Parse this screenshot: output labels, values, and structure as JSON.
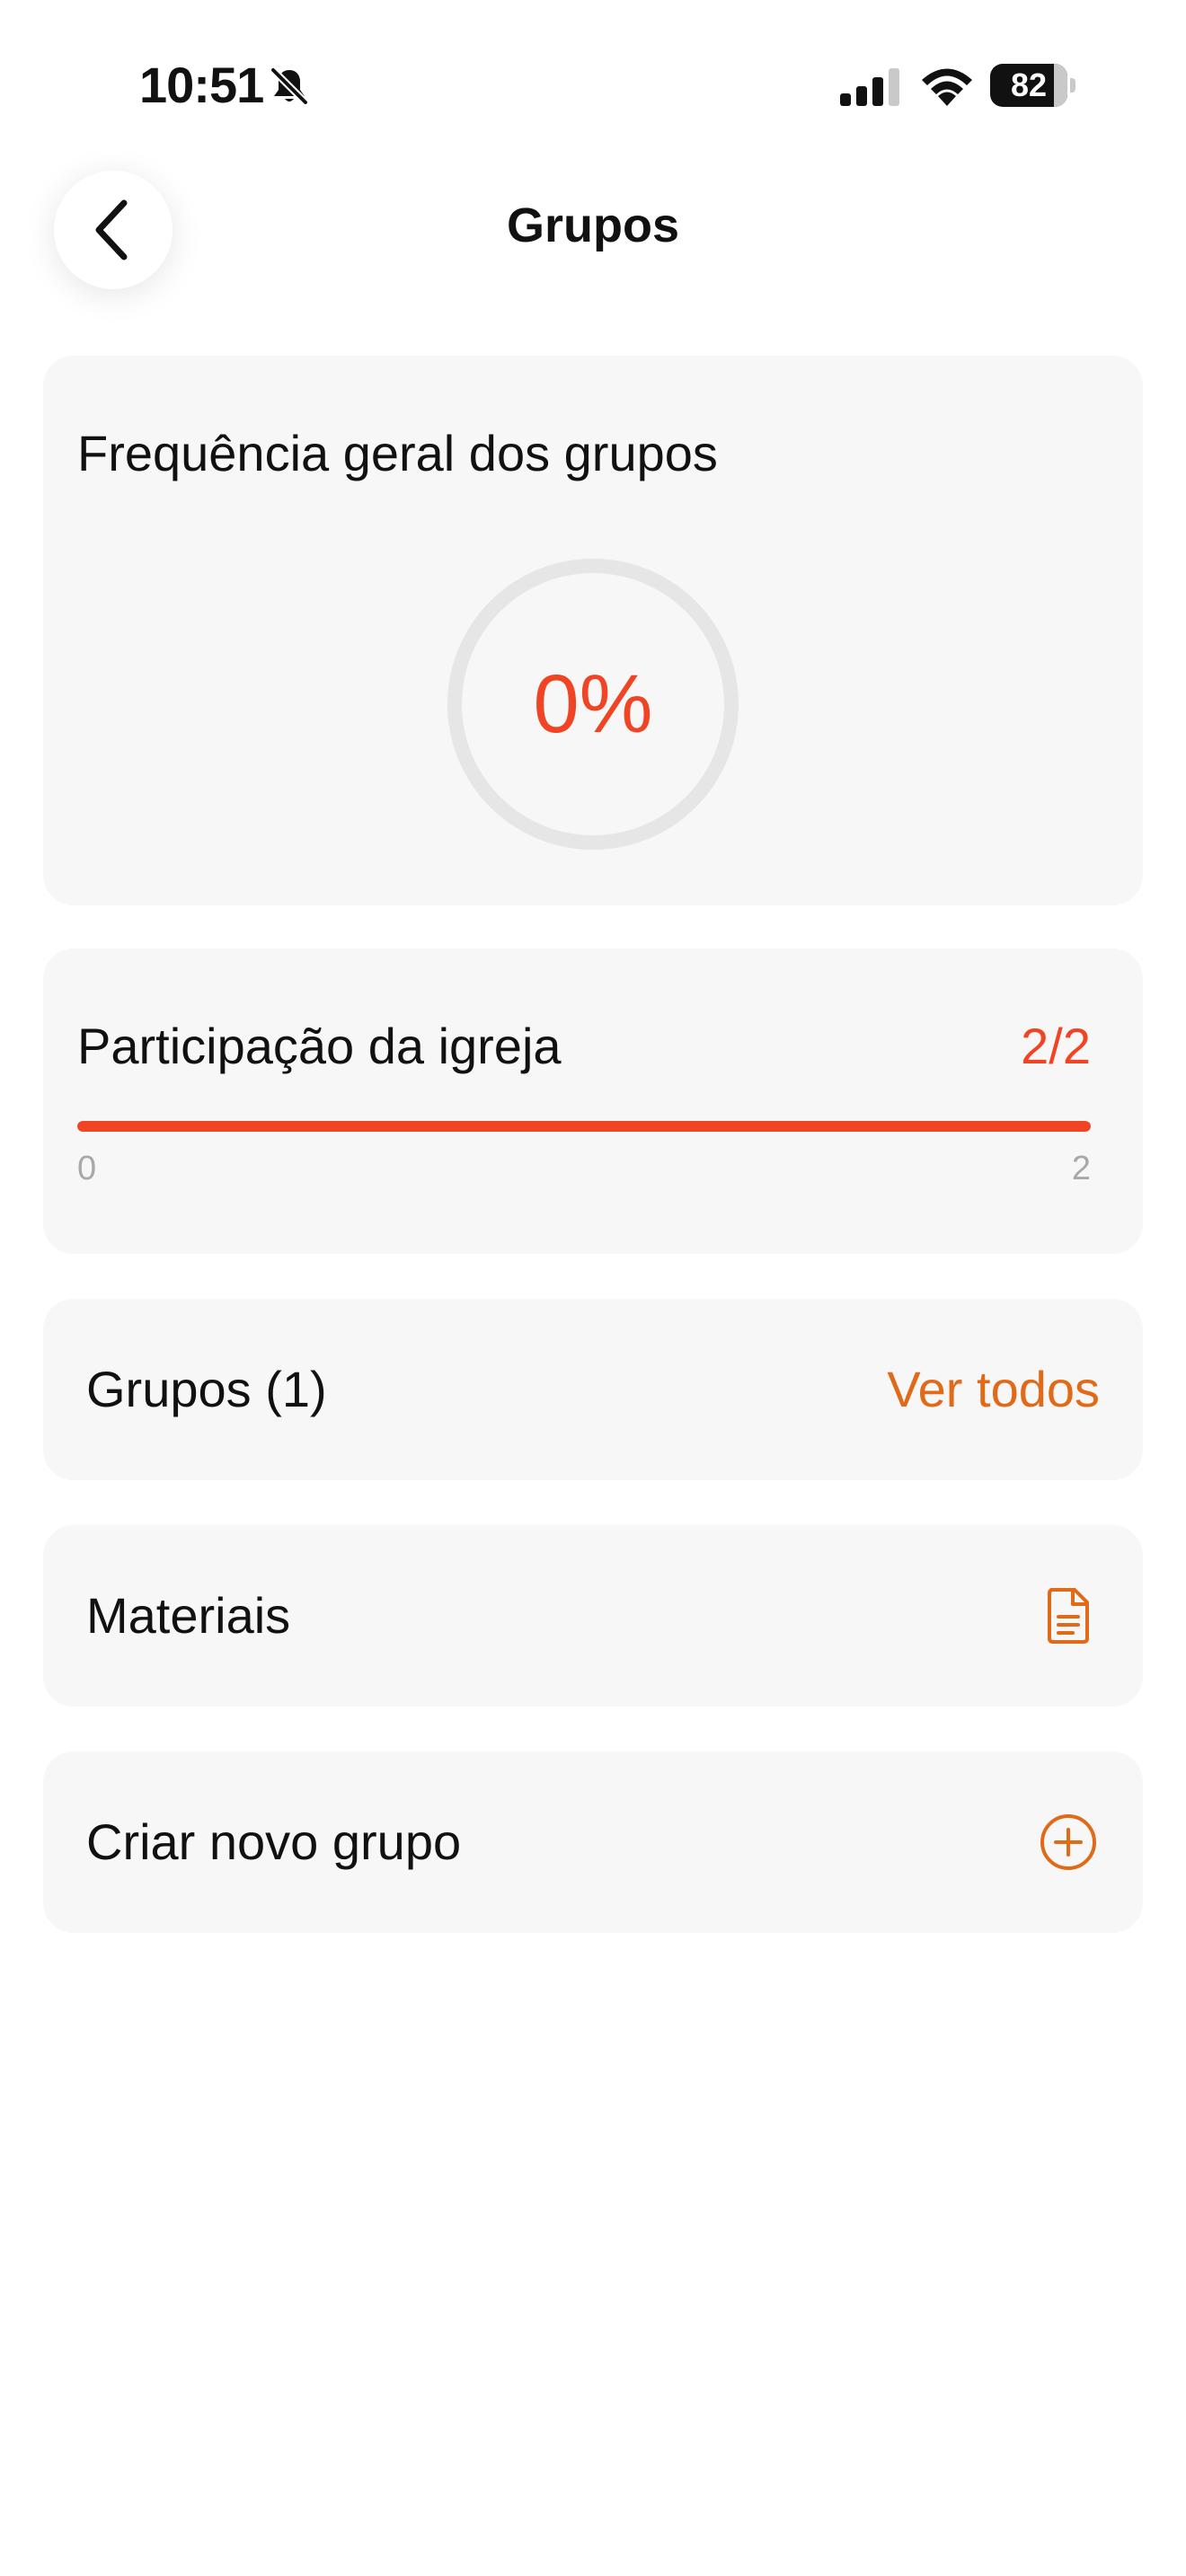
{
  "status_bar": {
    "time": "10:51",
    "battery_percent": "82",
    "battery_level": 0.82,
    "icons": [
      "bell-slash-icon",
      "cellular-signal-icon",
      "wifi-icon",
      "battery-icon"
    ]
  },
  "header": {
    "title": "Grupos",
    "back_icon": "chevron-left-icon"
  },
  "frequency_card": {
    "title": "Frequência geral dos grupos",
    "value": "0%",
    "percent": 0,
    "ring_color": "#e6e6e6",
    "value_color": "#f04424"
  },
  "participation_card": {
    "title": "Participação da igreja",
    "value": "2/2",
    "min_label": "0",
    "max_label": "2",
    "current": 2,
    "max": 2,
    "bar_color": "#f04424"
  },
  "groups_row": {
    "label": "Grupos (1)",
    "link": "Ver todos"
  },
  "materials_row": {
    "label": "Materiais",
    "icon": "document-icon"
  },
  "create_row": {
    "label": "Criar novo grupo",
    "icon": "plus-circle-icon"
  },
  "colors": {
    "accent_orange": "#e06a18",
    "accent_red": "#f04424",
    "card_background": "#f7f7f7"
  }
}
